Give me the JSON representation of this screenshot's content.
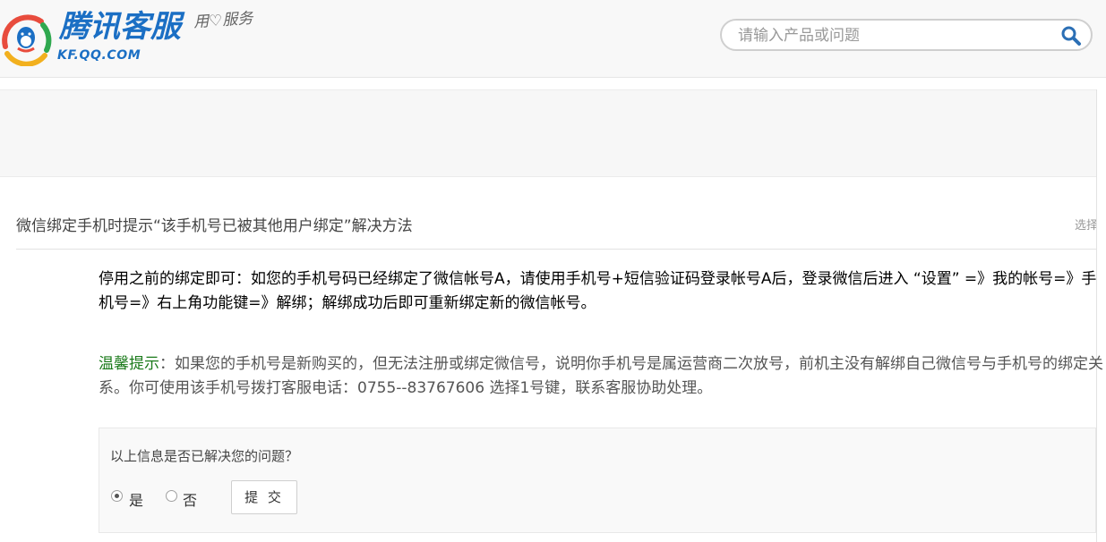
{
  "header": {
    "logo_title": "腾讯客服",
    "logo_domain": "KF.QQ.COM",
    "slogan": "用♡服务",
    "search": {
      "placeholder": "请输入产品或问题",
      "value": "",
      "icon": "search-icon"
    }
  },
  "article": {
    "title": "微信绑定手机时提示“该手机号已被其他用户绑定”解决方法",
    "select_link": "选择",
    "main_paragraph": "停用之前的绑定即可：如您的手机号码已经绑定了微信帐号A，请使用手机号+短信验证码登录帐号A后，登录微信后进入 “设置” =》我的帐号=》手机号=》右上角功能键=》解绑；解绑成功后即可重新绑定新的微信帐号。",
    "tip_label": "温馨提示",
    "tip_text": "：如果您的手机号是新购买的，但无法注册或绑定微信号，说明你手机号是属运营商二次放号，前机主没有解绑自己微信号与手机号的绑定关系。你可使用该手机号拨打客服电话：0755--83767606 选择1号键，联系客服协助处理。"
  },
  "feedback": {
    "question": "以上信息是否已解决您的问题？",
    "options": [
      {
        "label": "是",
        "checked": true
      },
      {
        "label": "否",
        "checked": false
      }
    ],
    "submit_label": "提 交"
  },
  "colors": {
    "brand_blue": "#1b6fc4",
    "tip_green": "#1a7a1a"
  }
}
